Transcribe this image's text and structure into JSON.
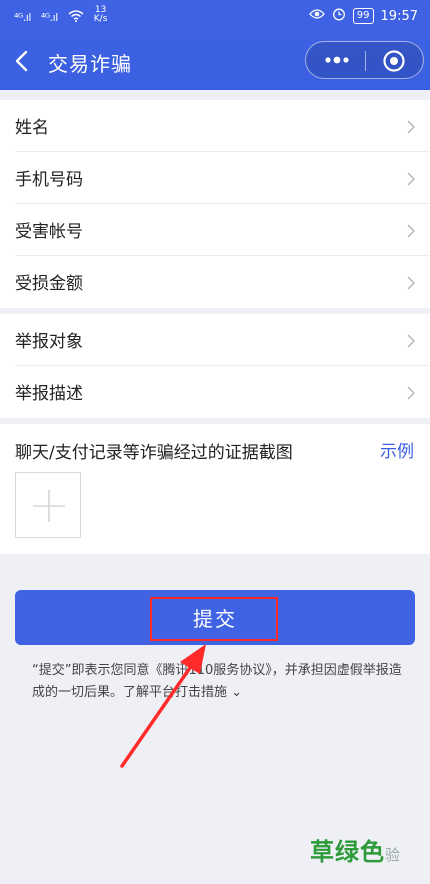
{
  "status_bar": {
    "signal1": "⁴ᴳ.ıl",
    "signal2": "⁴ᴳ.ıl",
    "net_speed_value": "13",
    "net_speed_unit": "K/s",
    "battery": "99",
    "time": "19:57"
  },
  "nav": {
    "title": "交易诈骗"
  },
  "form_group1": [
    {
      "label": "姓名"
    },
    {
      "label": "手机号码"
    },
    {
      "label": "受害帐号"
    },
    {
      "label": "受损金额"
    }
  ],
  "form_group2": [
    {
      "label": "举报对象"
    },
    {
      "label": "举报描述"
    }
  ],
  "evidence": {
    "title": "聊天/支付记录等诈骗经过的证据截图",
    "example_link": "示例"
  },
  "submit_label": "提交",
  "agreement": {
    "text_part1": "“提交”即表示您同意《腾讯110服务协议》，并承担因虚假举报造成的一切后果。",
    "link_text": "了解平台打击措施",
    "chevron": "⌄"
  },
  "watermark": {
    "text": "草绿色",
    "suffix": "验"
  },
  "colors": {
    "primary": "#3f63e3",
    "highlight": "#ff2b2b",
    "background": "#eef0f6",
    "watermark": "#2e9b3a"
  }
}
